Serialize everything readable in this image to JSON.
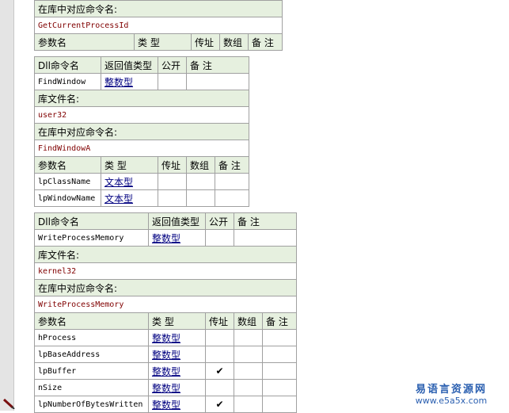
{
  "labels": {
    "dll_cmd": "Dll命令名",
    "return_type": "返回值类型",
    "public": "公开",
    "remark": "备 注",
    "lib_file": "库文件名:",
    "lib_cmd": "在库中对应命令名:",
    "param": "参数名",
    "type": "类 型",
    "by_addr": "传址",
    "array": "数组",
    "check": "✔"
  },
  "t0": {
    "lib_cmd_value": "GetCurrentProcessId"
  },
  "t1": {
    "name": "FindWindow",
    "ret": "整数型",
    "lib": "user32",
    "lib_cmd_value": "FindWindowA",
    "params": [
      {
        "name": "lpClassName",
        "type": "文本型"
      },
      {
        "name": "lpWindowName",
        "type": "文本型"
      }
    ]
  },
  "t2": {
    "name": "WriteProcessMemory",
    "ret": "整数型",
    "lib": "kernel32",
    "lib_cmd_value": "WriteProcessMemory",
    "params": [
      {
        "name": "hProcess",
        "type": "整数型"
      },
      {
        "name": "lpBaseAddress",
        "type": "整数型"
      },
      {
        "name": "lpBuffer",
        "type": "整数型",
        "by_addr": true
      },
      {
        "name": "nSize",
        "type": "整数型"
      },
      {
        "name": "lpNumberOfBytesWritten",
        "type": "整数型",
        "by_addr": true
      }
    ]
  },
  "watermark": {
    "cn": "易语言资源网",
    "url": "www.e5a5x.com"
  },
  "icons": {
    "pen": "pen-icon"
  },
  "colors": {
    "header_bg": "#e6f0df",
    "border": "#a0a0a0",
    "red_text": "#800000",
    "link": "#000080",
    "check": "#8b0000"
  }
}
